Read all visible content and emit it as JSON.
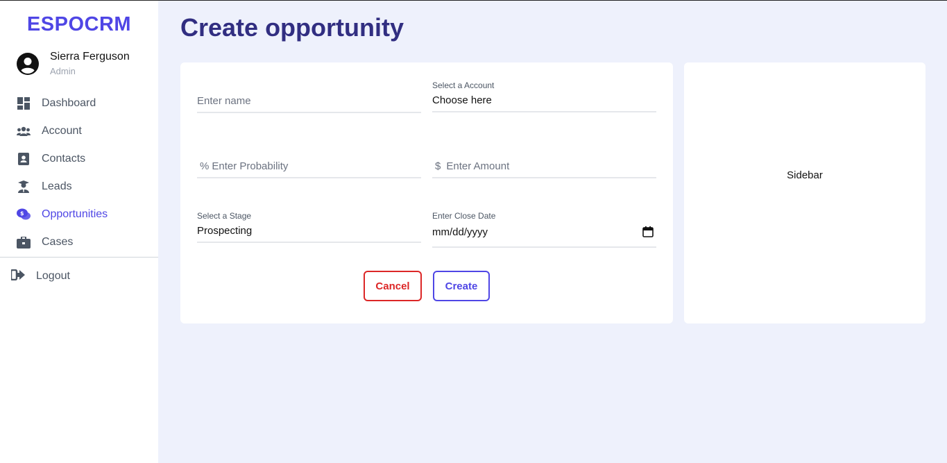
{
  "app": {
    "logo": "ESPOCRM",
    "accent": "#4f46e5"
  },
  "user": {
    "name": "Sierra Ferguson",
    "role": "Admin",
    "icon": "user-circle-icon"
  },
  "nav": {
    "items": [
      {
        "label": "Dashboard",
        "icon": "dashboard-icon",
        "active": false
      },
      {
        "label": "Account",
        "icon": "users-icon",
        "active": false
      },
      {
        "label": "Contacts",
        "icon": "contact-card-icon",
        "active": false
      },
      {
        "label": "Leads",
        "icon": "user-tie-icon",
        "active": false
      },
      {
        "label": "Opportunities",
        "icon": "comments-dollar-icon",
        "active": true
      },
      {
        "label": "Cases",
        "icon": "briefcase-icon",
        "active": false
      }
    ],
    "logout": "Logout"
  },
  "page": {
    "title": "Create opportunity"
  },
  "form": {
    "name": {
      "placeholder": "Enter name"
    },
    "account": {
      "label": "Select a Account",
      "value": "Choose here"
    },
    "probability": {
      "prefix": "%",
      "placeholder": "Enter Probability"
    },
    "amount": {
      "prefix": "$",
      "placeholder": "Enter Amount"
    },
    "stage": {
      "label": "Select a Stage",
      "value": "Prospecting"
    },
    "close_date": {
      "label": "Enter Close Date",
      "placeholder": "mm/dd/yyyy"
    },
    "cancel_label": "Cancel",
    "create_label": "Create"
  },
  "sidebar_panel": {
    "label": "Sidebar"
  }
}
